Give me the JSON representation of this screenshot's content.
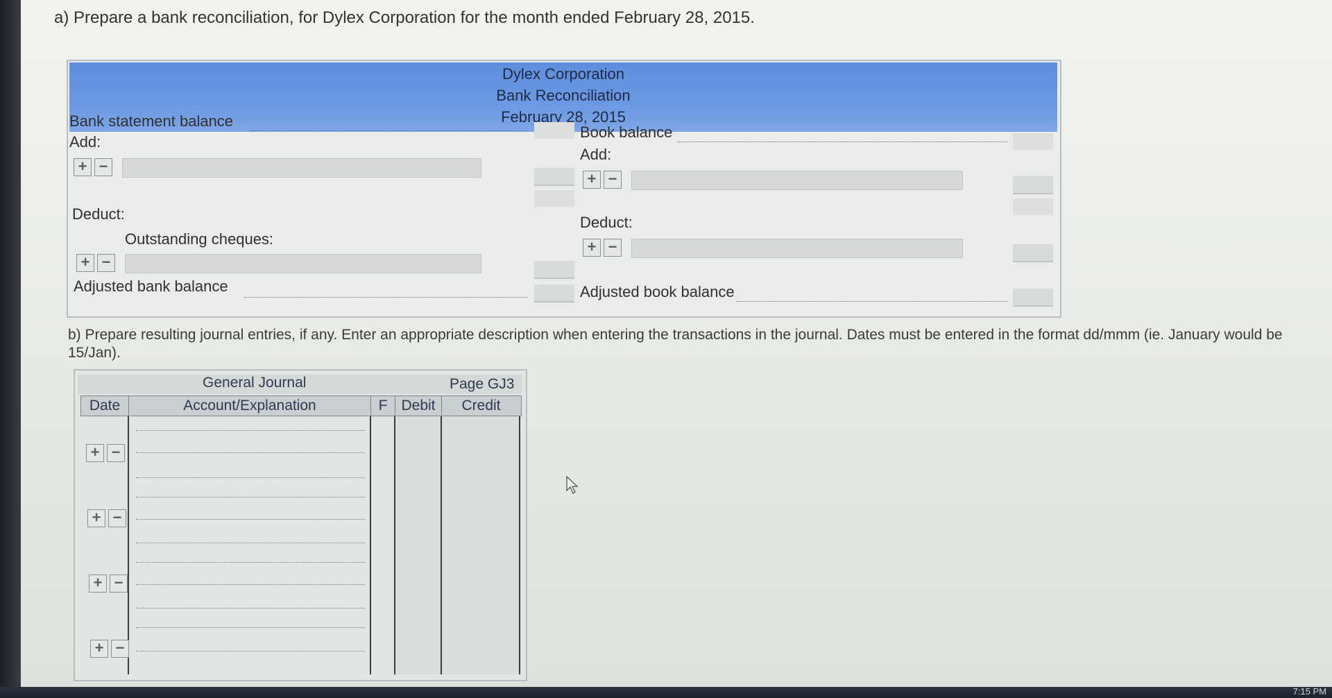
{
  "instructions": {
    "part_a": "a) Prepare a bank reconciliation, for Dylex Corporation for the month ended February 28, 2015.",
    "part_b": "b) Prepare resulting journal entries, if any. Enter an appropriate description when entering the transactions in the journal. Dates must be entered in the format dd/mmm (ie. January would be 15/Jan)."
  },
  "reconciliation": {
    "header": {
      "company": "Dylex Corporation",
      "title": "Bank Reconciliation",
      "date": "February 28, 2015"
    },
    "bank_side": {
      "statement_balance_label": "Bank statement balance",
      "add_label": "Add:",
      "deduct_label": "Deduct:",
      "outstanding_label": "Outstanding cheques:",
      "adjusted_label": "Adjusted bank balance"
    },
    "book_side": {
      "balance_label": "Book balance",
      "add_label": "Add:",
      "deduct_label": "Deduct:",
      "adjusted_label": "Adjusted book balance"
    },
    "buttons": {
      "add_row": "+",
      "remove_row": "−"
    }
  },
  "journal": {
    "title": "General Journal",
    "page": "Page GJ3",
    "columns": [
      "Date",
      "Account/Explanation",
      "F",
      "Debit",
      "Credit"
    ]
  },
  "system": {
    "clock": "7:15 PM"
  }
}
